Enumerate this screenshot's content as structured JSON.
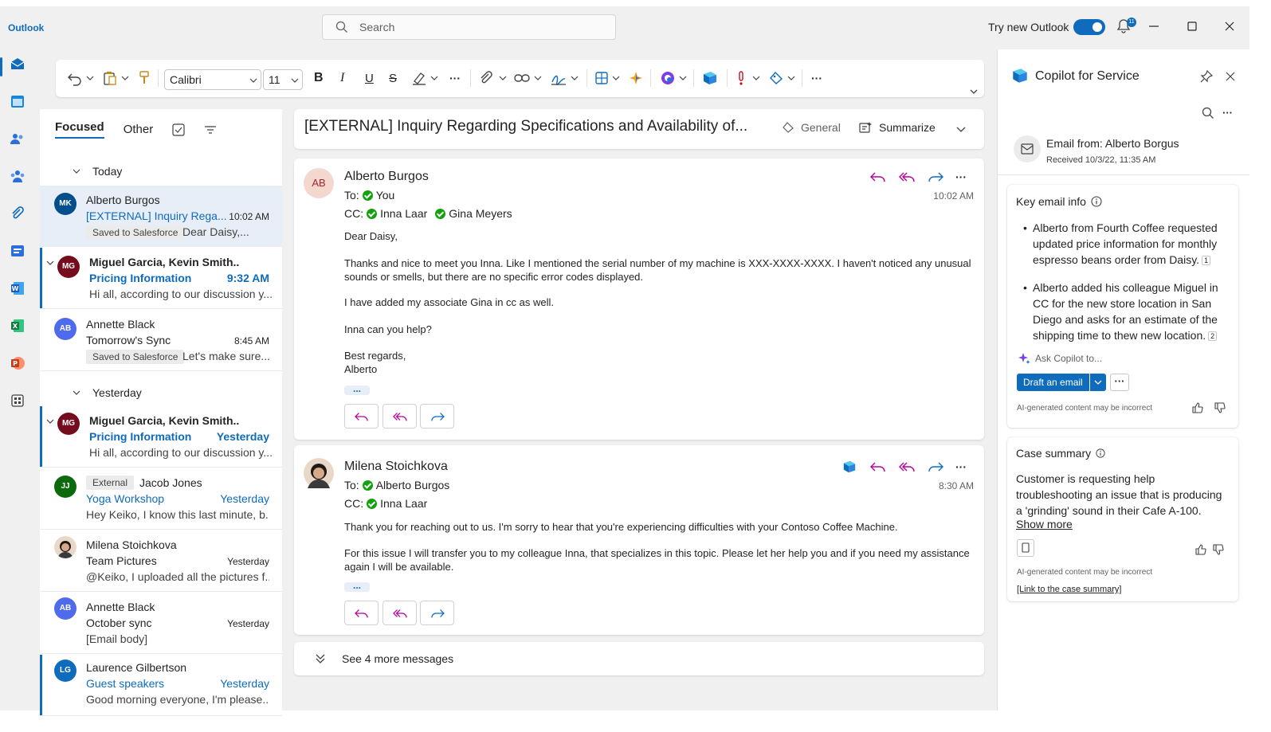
{
  "app": {
    "brand": "Outlook"
  },
  "search": {
    "placeholder": "Search"
  },
  "titlebar": {
    "try_new": "Try new Outlook",
    "notifications_count": "11"
  },
  "ribbon": {
    "font": "Calibri",
    "size": "11"
  },
  "list": {
    "tabs": {
      "focused": "Focused",
      "other": "Other"
    },
    "groups": {
      "today": "Today",
      "yesterday": "Yesterday"
    },
    "messages": [
      {
        "initials": "MK",
        "from": "Alberto Burgos",
        "subject": "[EXTERNAL] Inquiry Rega...",
        "time": "10:02 AM",
        "tag": "Saved to Salesforce",
        "preview": "Dear Daisy,..."
      },
      {
        "initials": "MG",
        "from": "Miguel Garcia, Kevin Smith..",
        "subject": "Pricing Information",
        "time": "9:32 AM",
        "preview": "Hi all, according to our discussion y..."
      },
      {
        "initials": "AB",
        "from": "Annette Black",
        "subject": "Tomorrow's Sync",
        "time": "8:45 AM",
        "tag": "Saved to Salesforce",
        "preview": "Let's make sure..."
      },
      {
        "initials": "MG",
        "from": "Miguel Garcia, Kevin Smith..",
        "subject": "Pricing Information",
        "time": "Yesterday",
        "preview": "Hi all, according to our discussion y..."
      },
      {
        "initials": "JJ",
        "tag": "External",
        "from": "Jacob Jones",
        "subject": "Yoga Workshop",
        "time": "Yesterday",
        "preview": "Hey Keiko, I know this last minute, b..."
      },
      {
        "from": "Milena Stoichkova",
        "subject": "Team Pictures",
        "time": "Yesterday",
        "preview": "@Keiko, I uploaded all the pictures f..."
      },
      {
        "initials": "AB",
        "from": "Annette Black",
        "subject": "October sync",
        "time": "Yesterday",
        "preview": "[Email body]"
      },
      {
        "initials": "LG",
        "from": "Laurence Gilbertson",
        "subject": "Guest speakers",
        "time": "Yesterday",
        "preview": "Good morning everyone, I'm please..."
      }
    ]
  },
  "reading": {
    "subject": "[EXTERNAL] Inquiry Regarding Specifications and Availability of...",
    "general": "General",
    "summarize": "Summarize",
    "msg1": {
      "initials": "AB",
      "sender": "Alberto Burgos",
      "to_label": "To:",
      "to": "You",
      "cc_label": "CC:",
      "cc1": "Inna Laar",
      "cc2": "Gina Meyers",
      "time": "10:02 AM",
      "p1": "Dear Daisy,",
      "p2": "Thanks and nice to meet you Inna. Like I mentioned the serial number of my machine is XXX-XXXX-XXXX. I haven't noticed any unusual sounds or smells, but there are no specific error codes displayed.",
      "p3": "I have added my associate Gina in cc as well.",
      "p4": "Inna can you help?",
      "p5": "Best regards,",
      "p6": "Alberto",
      "more": "..."
    },
    "msg2": {
      "sender": "Milena Stoichkova",
      "to_label": "To:",
      "to": "Alberto Burgos",
      "cc_label": "CC:",
      "cc1": "Inna Laar",
      "time": "8:30 AM",
      "p1": "Thank you for reaching out to us. I'm sorry to hear that you're experiencing difficulties with your Contoso Coffee Machine.",
      "p2": "For this issue I will transfer you to my colleague Inna, that specializes in this topic. Please let her help you and if you need my assistance again I will be available.",
      "more": "..."
    },
    "see_more": "See 4 more messages"
  },
  "copilot": {
    "title": "Copilot for Service",
    "email_from": "Email from: Alberto Borgus",
    "received": "Received 10/3/22, 11:35 AM",
    "key_info_title": "Key email info",
    "bullet1": "Alberto from Fourth Coffee requested updated price information for monthly espresso beans order from Daisy.",
    "bullet1_ref": "1",
    "bullet2": "Alberto added his colleague Miguel in CC for the new store location in San Diego and asks for an estimate of the shipping time to thew new location.",
    "bullet2_ref": "2",
    "ask": "Ask Copilot to...",
    "draft": "Draft an email",
    "disclaimer": "AI-generated content may be incorrect",
    "case_title": "Case summary",
    "case_text": "Customer is requesting help troubleshooting an issue that is producing a 'grinding' sound in their Cafe A-100.",
    "show_more": "Show more",
    "case_link": "[Link to the case summary]"
  },
  "colors": {
    "accent": "#0f6cbd",
    "check": "#13a10e"
  }
}
